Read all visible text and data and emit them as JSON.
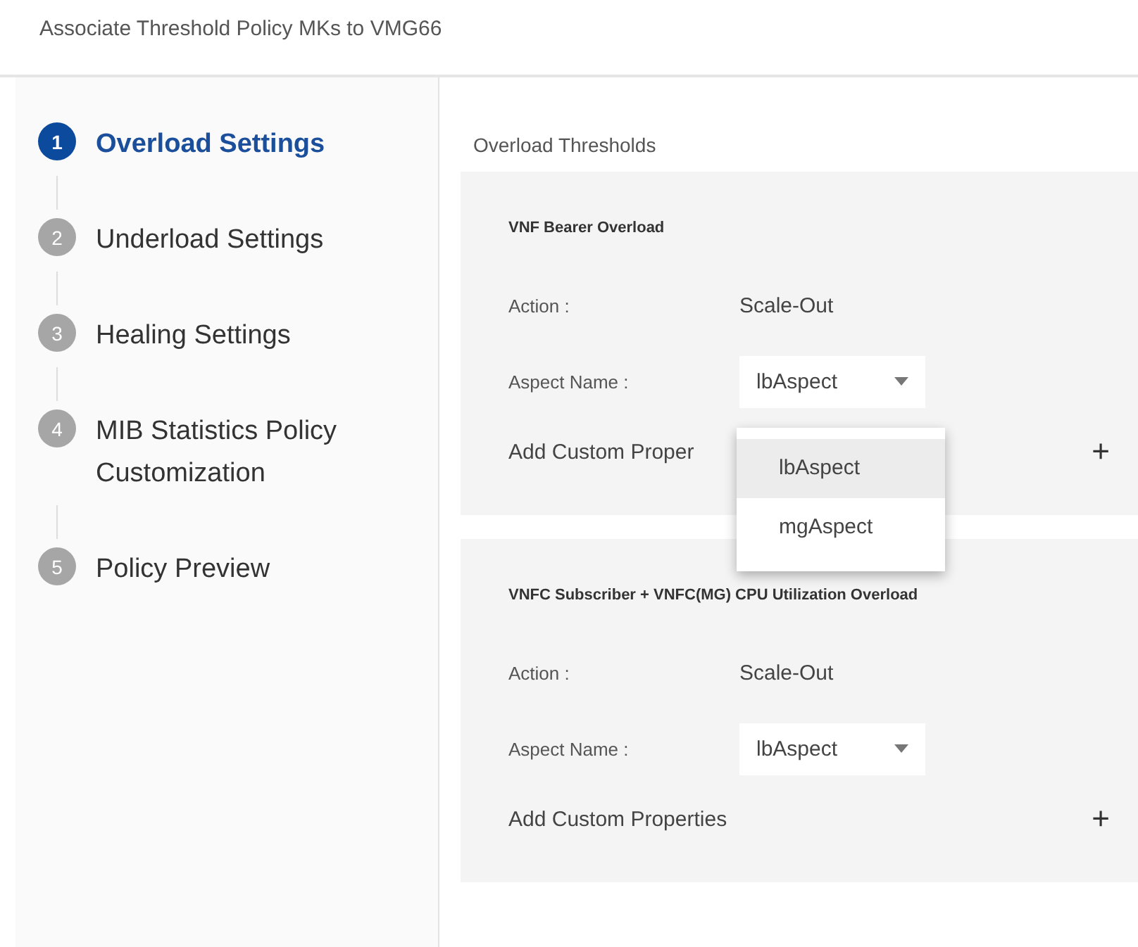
{
  "title": "Associate Threshold Policy MKs to VMG66",
  "steps": [
    {
      "number": "1",
      "label": "Overload Settings",
      "selected": true
    },
    {
      "number": "2",
      "label": "Underload Settings",
      "selected": false
    },
    {
      "number": "3",
      "label": "Healing Settings",
      "selected": false
    },
    {
      "number": "4",
      "label": "MIB Statistics Policy Customization",
      "selected": false
    },
    {
      "number": "5",
      "label": "Policy Preview",
      "selected": false
    }
  ],
  "section_title": "Overload Thresholds",
  "panels": [
    {
      "title": "VNF Bearer Overload",
      "action_label": "Action :",
      "action_value": "Scale-Out",
      "aspect_label": "Aspect Name :",
      "aspect": {
        "value": "lbAspect",
        "expanded": true,
        "options": [
          {
            "label": "lbAspect",
            "selected": true
          },
          {
            "label": "mgAspect",
            "selected": false
          }
        ]
      },
      "custom_label": "Add Custom Proper",
      "add_icon": "+"
    },
    {
      "title": "VNFC Subscriber + VNFC(MG) CPU Utilization Overload",
      "action_label": "Action :",
      "action_value": "Scale-Out",
      "aspect_label": "Aspect Name :",
      "aspect": {
        "value": "lbAspect",
        "expanded": false
      },
      "custom_label": "Add Custom Properties",
      "add_icon": "+"
    }
  ]
}
